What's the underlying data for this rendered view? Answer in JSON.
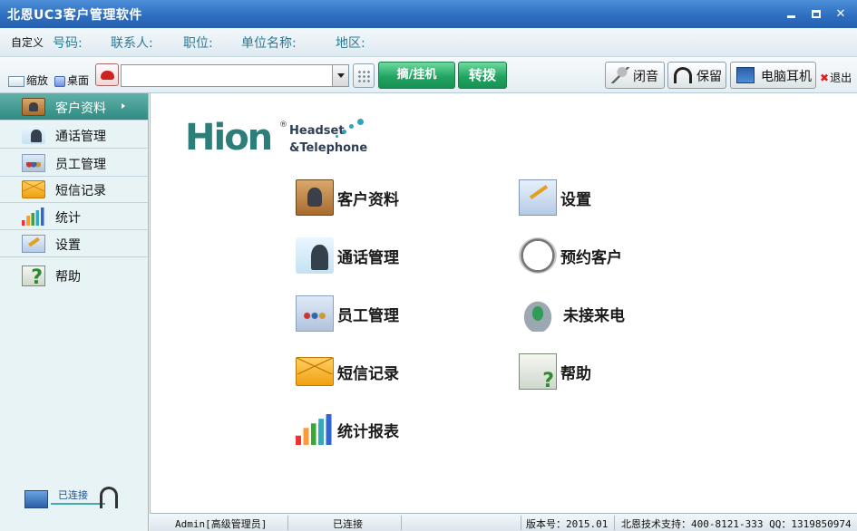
{
  "window": {
    "title": "北恩UC3客户管理软件"
  },
  "infobar": {
    "custom": "自定义",
    "phone_label": "号码:",
    "contact_label": "联系人:",
    "position_label": "职位:",
    "company_label": "单位名称:",
    "region_label": "地区:"
  },
  "toolbar": {
    "shrink": "缩放",
    "desktop": "桌面",
    "dial_value": "",
    "dial_label": "摘/挂机",
    "transfer_label": "转拨",
    "mute_label": "闭音",
    "hold_label": "保留",
    "pc_headset_label": "电脑耳机",
    "exit_label": "退出"
  },
  "sidebar": {
    "items": [
      {
        "label": "客户资料",
        "icon": "customer-icon",
        "active": true
      },
      {
        "label": "通话管理",
        "icon": "call-management-icon"
      },
      {
        "label": "员工管理",
        "icon": "staff-icon"
      },
      {
        "label": "短信记录",
        "icon": "sms-icon"
      },
      {
        "label": "统计",
        "icon": "statistics-icon"
      },
      {
        "label": "设置",
        "icon": "settings-icon"
      },
      {
        "label": "帮助",
        "icon": "help-icon"
      }
    ],
    "connection_status": "已连接"
  },
  "logo": {
    "brand": "Hion",
    "registered": "®",
    "line1": "Headset",
    "line2": "&Telephone"
  },
  "main": {
    "tiles": [
      {
        "label": "客户资料",
        "icon": "customer-icon"
      },
      {
        "label": "设置",
        "icon": "settings-icon"
      },
      {
        "label": "通话管理",
        "icon": "call-management-icon"
      },
      {
        "label": "预约客户",
        "icon": "alarm-clock-icon"
      },
      {
        "label": "员工管理",
        "icon": "staff-icon"
      },
      {
        "label": "未接来电",
        "icon": "missed-call-icon"
      },
      {
        "label": "短信记录",
        "icon": "sms-icon"
      },
      {
        "label": "帮助",
        "icon": "help-icon"
      },
      {
        "label": "统计报表",
        "icon": "statistics-icon"
      }
    ]
  },
  "statusbar": {
    "user": "Admin[高级管理员]",
    "connection": "已连接",
    "version": "版本号：2015.01",
    "support": "北恩技术支持：400-8121-333 QQ：1319850974"
  }
}
